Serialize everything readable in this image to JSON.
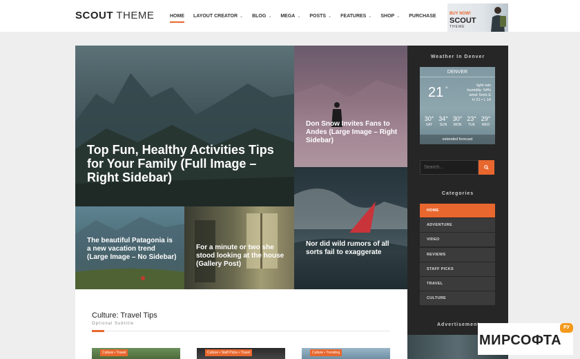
{
  "header": {
    "logo_bold": "SCOUT",
    "logo_light": " THEME",
    "nav": [
      {
        "label": "HOME",
        "has_dropdown": false,
        "active": true
      },
      {
        "label": "LAYOUT CREATOR",
        "has_dropdown": true
      },
      {
        "label": "BLOG",
        "has_dropdown": true
      },
      {
        "label": "MEGA",
        "has_dropdown": true
      },
      {
        "label": "POSTS",
        "has_dropdown": true
      },
      {
        "label": "FEATURES",
        "has_dropdown": true
      },
      {
        "label": "SHOP",
        "has_dropdown": true
      },
      {
        "label": "PURCHASE",
        "has_dropdown": false
      }
    ],
    "ad": {
      "buy": "BUY NOW!",
      "scout": "SCOUT",
      "theme": "THEME"
    }
  },
  "featured": {
    "big": "Top Fun, Healthy Activities Tips for Your Family (Full Image – Right Sidebar)",
    "andes": "Don Snow Invites Fans to Andes (Large Image – Right Sidebar)",
    "windsurf": "Nor did wild rumors of all sorts fail to exaggerate",
    "patagonia": "The beautiful Patagonia is a new vacation trend (Large Image – No Sidebar)",
    "stood": "For a minute or two she stood looking at the house (Gallery Post)"
  },
  "section": {
    "title": "Culture: Travel Tips",
    "subtitle": "Optional Subtitle",
    "cards": [
      {
        "tag": "Culture • Travel"
      },
      {
        "tag": "Culture • Staff Picks • Travel"
      },
      {
        "tag": "Culture • Trending"
      }
    ]
  },
  "sidebar": {
    "weather_heading": "Weather In Denver",
    "weather": {
      "city": "DENVER",
      "temp": "21",
      "deg": "°",
      "details": [
        "light rain",
        "humidity: 64%",
        "wind: 5m/s E",
        "H 21 • L 14"
      ],
      "forecast": [
        {
          "temp": "30°",
          "day": "SAT"
        },
        {
          "temp": "34°",
          "day": "SUN"
        },
        {
          "temp": "30°",
          "day": "MON"
        },
        {
          "temp": "23°",
          "day": "TUE"
        },
        {
          "temp": "29°",
          "day": "WED"
        }
      ],
      "extended": "extended forecast"
    },
    "search_placeholder": "Search...",
    "categories_heading": "Categories",
    "categories": [
      "HOME",
      "ADVENTURE",
      "VIDEO",
      "REVIEWS",
      "STAFF PICKS",
      "TRAVEL",
      "CULTURE"
    ],
    "ad_heading": "Advertisement"
  },
  "watermark": {
    "text": "МИРСОФТА",
    "badge": "РУ"
  },
  "colors": {
    "accent": "#e8672e",
    "sidebar": "#262626",
    "background": "#eeeeee"
  }
}
